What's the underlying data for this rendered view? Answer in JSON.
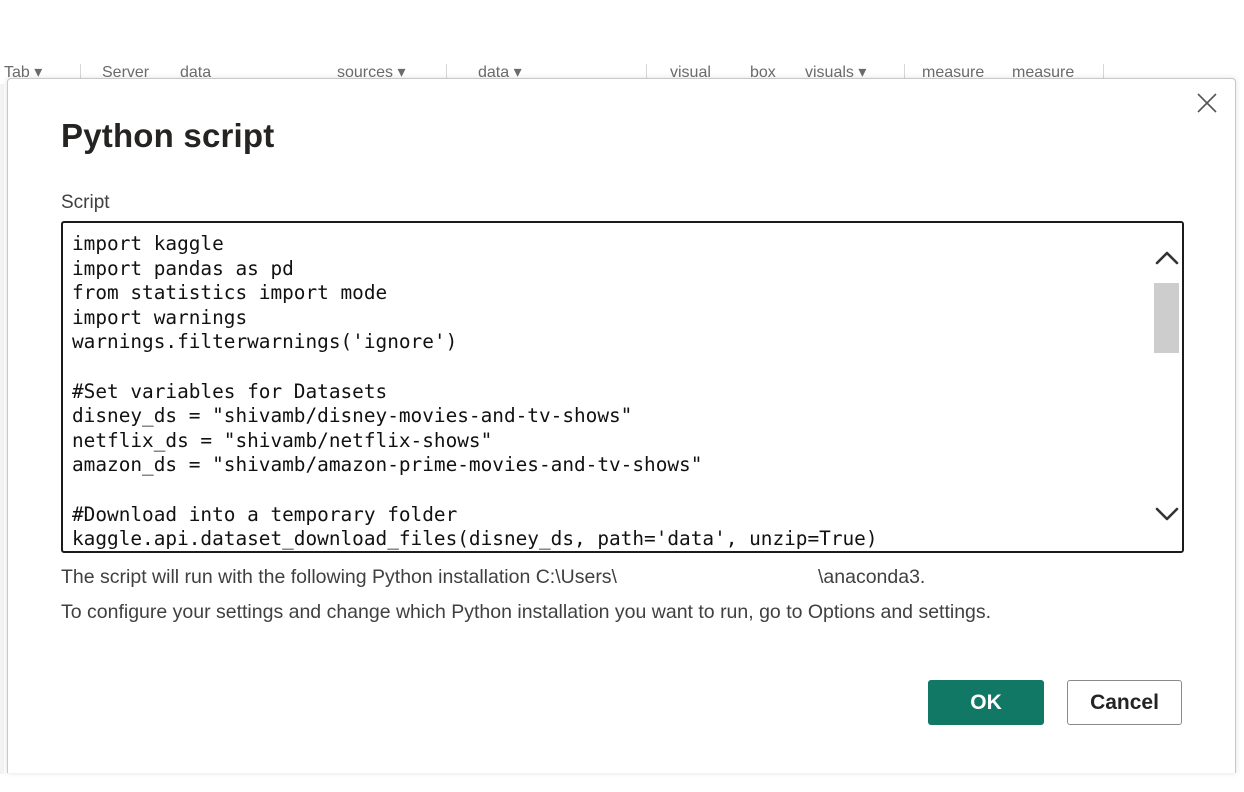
{
  "ribbon": {
    "items": [
      "Tab ▾",
      "Server",
      "data",
      "sources ▾",
      "data ▾",
      "visual",
      "box",
      "visuals ▾",
      "measure",
      "measure"
    ]
  },
  "dialog": {
    "title": "Python script",
    "close_icon": "close-icon",
    "script_label": "Script",
    "code_lines": [
      "import kaggle",
      "import pandas as pd",
      "from statistics import mode",
      "import warnings",
      "warnings.filterwarnings('ignore')",
      "",
      "#Set variables for Datasets",
      "disney_ds = \"shivamb/disney-movies-and-tv-shows\"",
      "netflix_ds = \"shivamb/netflix-shows\"",
      "amazon_ds = \"shivamb/amazon-prime-movies-and-tv-shows\"",
      "",
      "#Download into a temporary folder",
      "kaggle.api.dataset_download_files(disney_ds, path='data', unzip=True)"
    ],
    "scroll_up_icon": "chevron-up-icon",
    "scroll_down_icon": "chevron-down-icon",
    "info_line_1_prefix": "The script will run with the following Python installation C:\\Users\\",
    "info_line_1_suffix": "\\anaconda3.",
    "info_line_2": "To configure your settings and change which Python installation you want to run, go to Options and settings.",
    "ok_label": "OK",
    "cancel_label": "Cancel"
  },
  "colors": {
    "ok_button": "#117865",
    "title_text": "#252423",
    "body_text": "#404040",
    "editor_border": "#1b1b1b",
    "scroll_thumb": "#cdcdcd"
  }
}
